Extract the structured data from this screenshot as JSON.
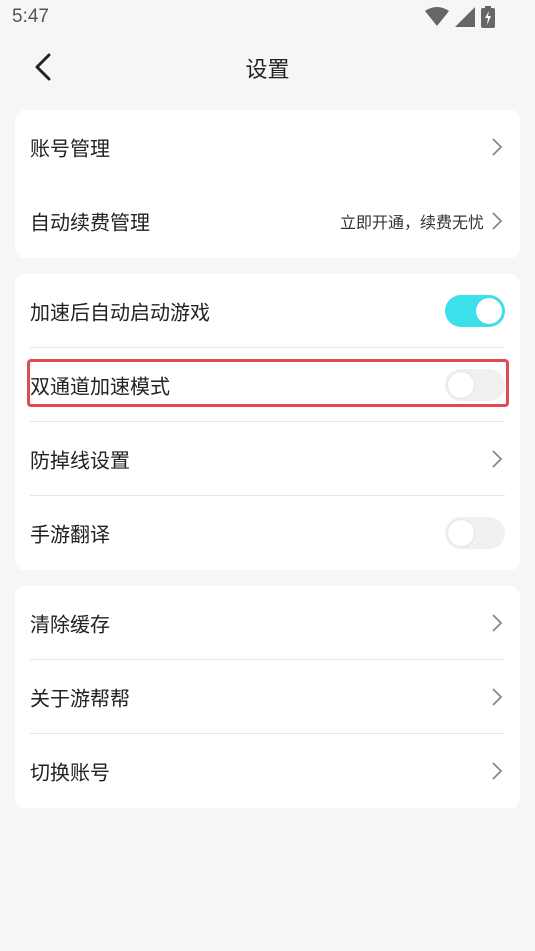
{
  "status_bar": {
    "time": "5:47",
    "icons": [
      "wifi-icon",
      "signal-icon",
      "battery-icon"
    ]
  },
  "nav": {
    "title": "设置",
    "back_icon": "back-arrow-icon"
  },
  "card1": {
    "items": [
      {
        "label": "账号管理",
        "type": "link"
      },
      {
        "label": "自动续费管理",
        "extra": "立即开通，续费无忧",
        "type": "link"
      }
    ]
  },
  "card2": {
    "items": [
      {
        "label": "加速后自动启动游戏",
        "type": "toggle",
        "on": true
      },
      {
        "label": "双通道加速模式",
        "type": "toggle",
        "on": false
      },
      {
        "label": "防掉线设置",
        "type": "link"
      },
      {
        "label": "手游翻译",
        "type": "toggle",
        "on": false
      }
    ]
  },
  "card3": {
    "items": [
      {
        "label": "清除缓存",
        "type": "link"
      },
      {
        "label": "关于游帮帮",
        "type": "link"
      },
      {
        "label": "切换账号",
        "type": "link"
      }
    ]
  },
  "colors": {
    "accent": "#3be0ea",
    "highlight": "#e04b55",
    "background": "#f5f6f8"
  }
}
